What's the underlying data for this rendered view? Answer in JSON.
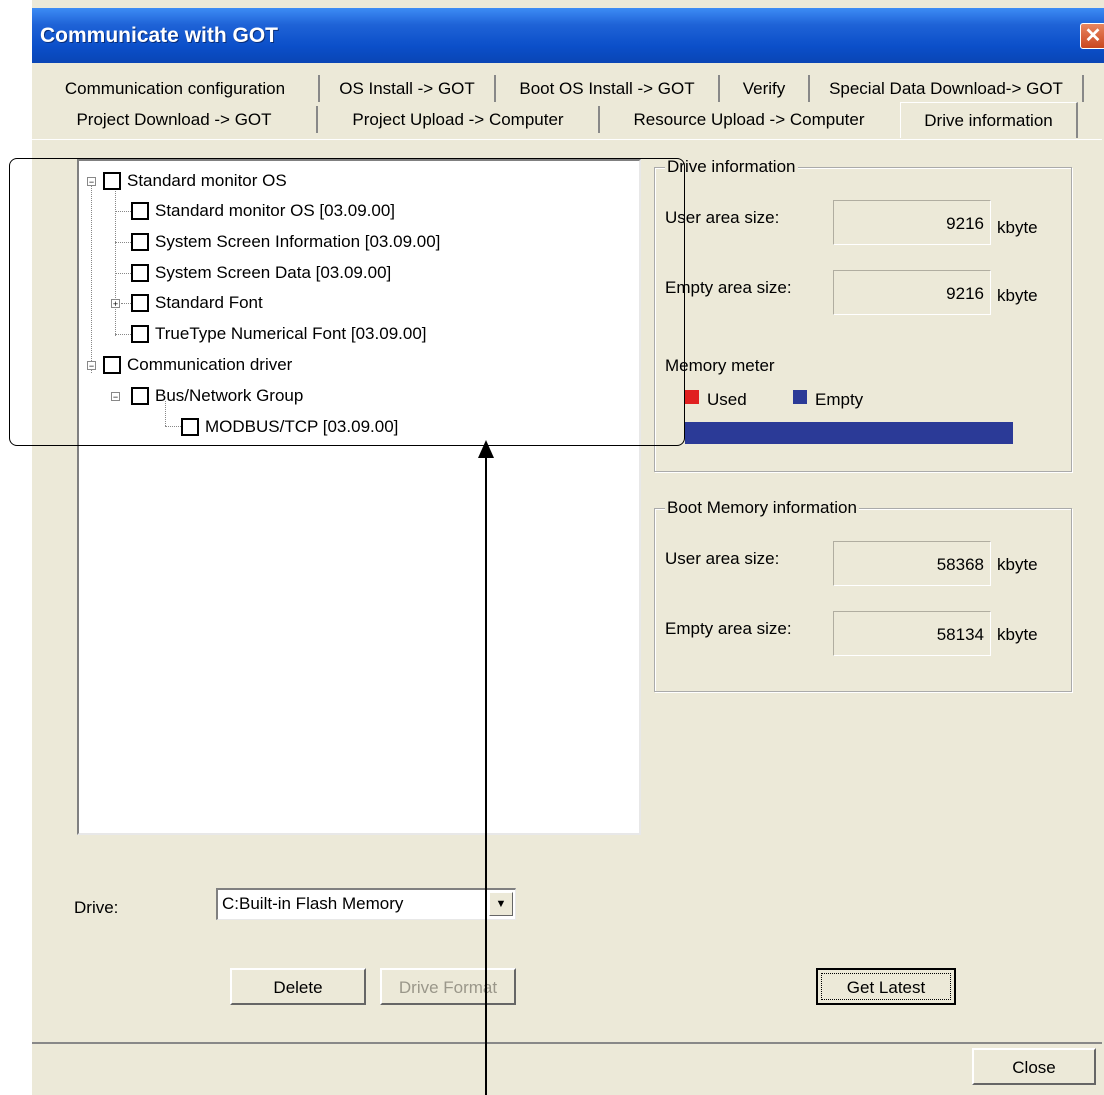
{
  "window": {
    "title": "Communicate with GOT",
    "close_glyph": "✕"
  },
  "tabs_row1": [
    "Communication configuration",
    "OS Install -> GOT",
    "Boot OS Install -> GOT",
    "Verify",
    "Special Data Download-> GOT"
  ],
  "tabs_row2": [
    "Project Download -> GOT",
    "Project Upload -> Computer",
    "Resource Upload -> Computer",
    "Drive information"
  ],
  "tree": {
    "root1": "Standard monitor OS",
    "items1": [
      "Standard monitor OS [03.09.00]",
      "System Screen Information [03.09.00]",
      "System Screen Data [03.09.00]",
      "Standard Font",
      "TrueType Numerical Font [03.09.00]"
    ],
    "root2": "Communication driver",
    "group2": "Bus/Network Group",
    "leaf2": "MODBUS/TCP [03.09.00]"
  },
  "drive_info": {
    "legend": "Drive information",
    "user_area_label": "User area size:",
    "user_area_value": "9216",
    "empty_area_label": "Empty area size:",
    "empty_area_value": "9216",
    "unit": "kbyte",
    "memory_meter_label": "Memory meter",
    "used_label": "Used",
    "empty_label": "Empty",
    "used_color": "#e02020",
    "empty_color": "#2b3a97",
    "used_fraction": 0
  },
  "boot_info": {
    "legend": "Boot Memory information",
    "user_area_label": "User area size:",
    "user_area_value": "58368",
    "empty_area_label": "Empty area size:",
    "empty_area_value": "58134",
    "unit": "kbyte"
  },
  "drive": {
    "label": "Drive:",
    "selected": "C:Built-in Flash Memory"
  },
  "buttons": {
    "delete": "Delete",
    "drive_format": "Drive Format",
    "get_latest": "Get Latest",
    "close": "Close"
  }
}
